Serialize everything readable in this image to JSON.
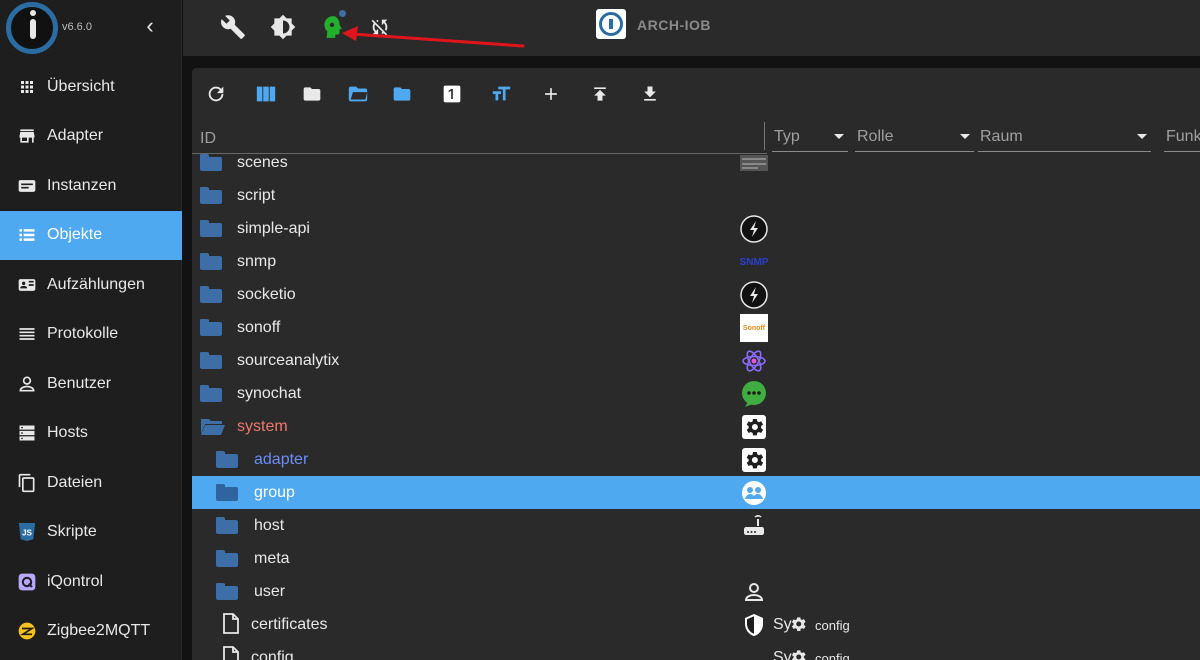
{
  "app": {
    "version": "v6.6.0",
    "collapse_glyph": "‹"
  },
  "sidebar": {
    "items": [
      {
        "label": "Übersicht",
        "icon": "grid-icon"
      },
      {
        "label": "Adapter",
        "icon": "store-icon"
      },
      {
        "label": "Instanzen",
        "icon": "instances-icon"
      },
      {
        "label": "Objekte",
        "icon": "list-icon",
        "active": true
      },
      {
        "label": "Aufzählungen",
        "icon": "enum-icon"
      },
      {
        "label": "Protokolle",
        "icon": "log-icon"
      },
      {
        "label": "Benutzer",
        "icon": "user-icon"
      },
      {
        "label": "Hosts",
        "icon": "hosts-icon"
      },
      {
        "label": "Dateien",
        "icon": "files-icon"
      },
      {
        "label": "Skripte",
        "icon": "js-icon"
      },
      {
        "label": "iQontrol",
        "icon": "iqontrol-icon"
      },
      {
        "label": "Zigbee2MQTT",
        "icon": "zigbee-icon"
      }
    ]
  },
  "topbar": {
    "host_name": "ARCH-IOB",
    "icons": [
      "wrench-icon",
      "theme-toggle-icon",
      "expert-mode-icon",
      "sync-off-icon",
      "iobroker-host-icon"
    ],
    "annotation": "red-arrow"
  },
  "objects": {
    "toolbar": [
      "refresh-icon",
      "columns-icon",
      "folder-icon",
      "folder-open-icon",
      "folder-closed-icon",
      "number-one-icon",
      "text-size-icon",
      "add-icon",
      "upload-icon",
      "download-icon"
    ],
    "columns": {
      "id": "ID",
      "filters": [
        {
          "label": "Typ"
        },
        {
          "label": "Rolle"
        },
        {
          "label": "Raum"
        },
        {
          "label": "Funk"
        }
      ]
    },
    "rows": [
      {
        "name": "scenes",
        "type": "folder",
        "level": 0,
        "adapter_icon": "scenes-thumb"
      },
      {
        "name": "script",
        "type": "folder",
        "level": 0,
        "adapter_icon": ""
      },
      {
        "name": "simple-api",
        "type": "folder",
        "level": 0,
        "adapter_icon": "bolt-circle"
      },
      {
        "name": "snmp",
        "type": "folder",
        "level": 0,
        "adapter_icon": "snmp-text",
        "adapter_text": "SNMP"
      },
      {
        "name": "socketio",
        "type": "folder",
        "level": 0,
        "adapter_icon": "bolt-circle"
      },
      {
        "name": "sonoff",
        "type": "folder",
        "level": 0,
        "adapter_icon": "sonoff-logo",
        "adapter_text": "Sonoff"
      },
      {
        "name": "sourceanalytix",
        "type": "folder",
        "level": 0,
        "adapter_icon": "atom-icon"
      },
      {
        "name": "synochat",
        "type": "folder",
        "level": 0,
        "adapter_icon": "chat-bubble"
      },
      {
        "name": "system",
        "type": "folder-open",
        "level": 0,
        "adapter_icon": "gear-box"
      },
      {
        "name": "adapter",
        "type": "folder",
        "level": 1,
        "adapter_icon": "gear-box"
      },
      {
        "name": "group",
        "type": "folder",
        "level": 1,
        "adapter_icon": "group-icon",
        "selected": true
      },
      {
        "name": "host",
        "type": "folder",
        "level": 1,
        "adapter_icon": "router-icon"
      },
      {
        "name": "meta",
        "type": "folder",
        "level": 1,
        "adapter_icon": ""
      },
      {
        "name": "user",
        "type": "folder",
        "level": 1,
        "adapter_icon": "person-icon"
      },
      {
        "name": "certificates",
        "type": "file",
        "level": 1,
        "adapter_icon": "shield-icon",
        "extra_prefix": "Sy",
        "extra_role": "config"
      },
      {
        "name": "config",
        "type": "file",
        "level": 1,
        "adapter_icon": "",
        "extra_prefix": "Sy",
        "extra_role": "config"
      }
    ]
  },
  "colors": {
    "accent": "#4ea9f0",
    "folder": "#3d6ea8",
    "open_folder_text": "#f0786d",
    "subfolder_text": "#6b8df5",
    "expert_icon": "#22b02c",
    "annotation_arrow": "#e0151c"
  }
}
